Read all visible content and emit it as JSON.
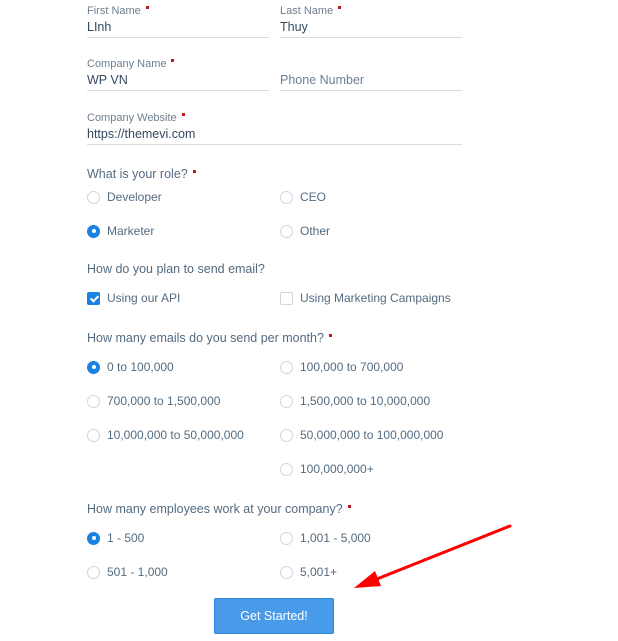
{
  "fields": {
    "first_name": {
      "label": "First Name",
      "value": "LInh",
      "required": true
    },
    "last_name": {
      "label": "Last Name",
      "value": "Thuy",
      "required": true
    },
    "company_name": {
      "label": "Company Name",
      "value": "WP VN",
      "required": true
    },
    "phone_number": {
      "placeholder": "Phone Number"
    },
    "company_website": {
      "label": "Company Website",
      "value": "https://themevi.com",
      "required": true
    }
  },
  "role": {
    "question": "What is your role?",
    "options": [
      "Developer",
      "CEO",
      "Marketer",
      "Other"
    ],
    "selected": "Marketer"
  },
  "send_method": {
    "question": "How do you plan to send email?",
    "options": [
      "Using our API",
      "Using Marketing Campaigns"
    ],
    "checked": [
      "Using our API"
    ]
  },
  "emails_per_month": {
    "question": "How many emails do you send per month?",
    "options": [
      "0 to 100,000",
      "100,000 to 700,000",
      "700,000 to 1,500,000",
      "1,500,000 to 10,000,000",
      "10,000,000 to 50,000,000",
      "50,000,000 to 100,000,000",
      "100,000,000+"
    ],
    "selected": "0 to 100,000"
  },
  "employees": {
    "question": "How many employees work at your company?",
    "options": [
      "1 - 500",
      "1,001 - 5,000",
      "501 - 1,000",
      "5,001+"
    ],
    "selected": "1 - 500"
  },
  "submit": {
    "label": "Get Started!"
  },
  "colors": {
    "accent": "#1a82e2",
    "button": "#489be8",
    "required": "#c0161f",
    "annotation_arrow": "#ff0000"
  }
}
